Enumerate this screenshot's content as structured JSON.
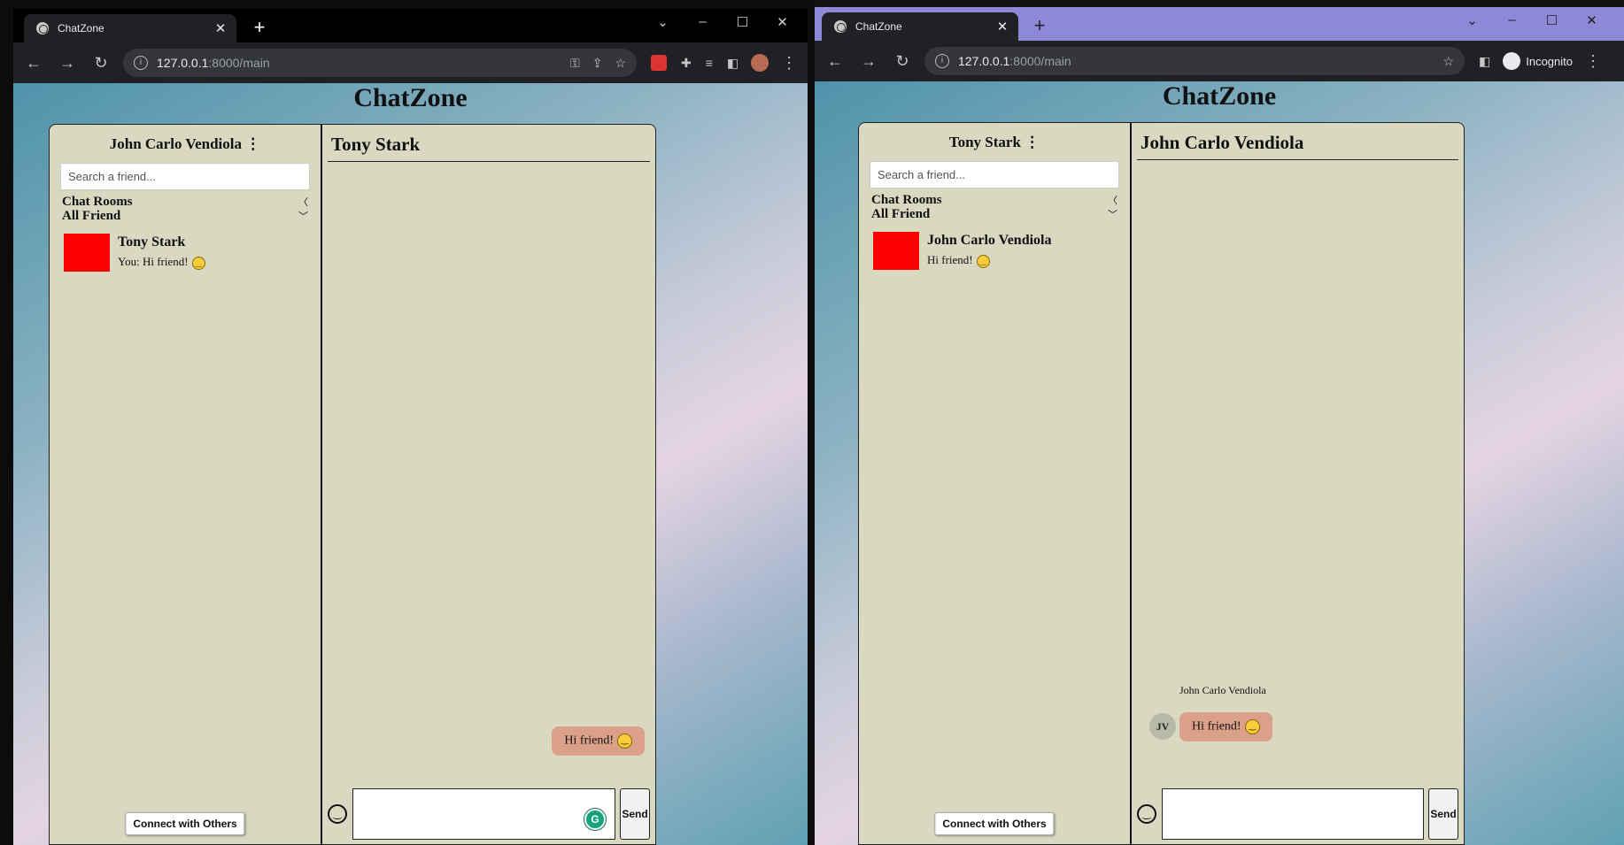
{
  "left_window": {
    "tab": {
      "title": "ChatZone",
      "close": "✕"
    },
    "new_tab": "+",
    "url": {
      "host": "127.0.0.1",
      "rest": ":8000/main"
    },
    "app_title": "ChatZone",
    "sidebar": {
      "user_name": "John Carlo Vendiola ⋮",
      "search_placeholder": "Search a friend...",
      "chat_rooms": "Chat Rooms",
      "all_friend": "All Friend",
      "friends": [
        {
          "name": "Tony Stark",
          "last_message": "You: Hi friend!"
        }
      ],
      "connect_button": "Connect with Others"
    },
    "chat": {
      "header": "Tony Stark",
      "messages": [
        {
          "text": "Hi friend!",
          "sender": "self"
        }
      ],
      "send_button": "Send"
    }
  },
  "right_window": {
    "tab": {
      "title": "ChatZone",
      "close": "✕"
    },
    "new_tab": "+",
    "url": {
      "host": "127.0.0.1",
      "rest": ":8000/main"
    },
    "incognito_label": "Incognito",
    "app_title": "ChatZone",
    "sidebar": {
      "user_name": "Tony Stark ⋮",
      "search_placeholder": "Search a friend...",
      "chat_rooms": "Chat Rooms",
      "all_friend": "All Friend",
      "friends": [
        {
          "name": "John Carlo Vendiola",
          "last_message": "Hi friend!"
        }
      ],
      "connect_button": "Connect with Others"
    },
    "chat": {
      "header": "John Carlo Vendiola",
      "messages": [
        {
          "text": "Hi friend!",
          "sender_name": "John Carlo Vendiola",
          "sender_initials": "JV"
        }
      ],
      "send_button": "Send"
    }
  },
  "colors": {
    "bubble": "#dba08a",
    "panel": "#d9d8c0",
    "avatar_placeholder": "#ff0000",
    "incognito_frame": "#8e88d8"
  },
  "icons": [
    "globe-icon",
    "back-icon",
    "forward-icon",
    "reload-icon",
    "info-icon",
    "key-icon",
    "share-icon",
    "star-icon",
    "extensions-icon",
    "sidepanel-icon",
    "menu-icon",
    "smiley-icon",
    "grammarly-icon",
    "chevron-left-icon",
    "chevron-down-icon"
  ]
}
